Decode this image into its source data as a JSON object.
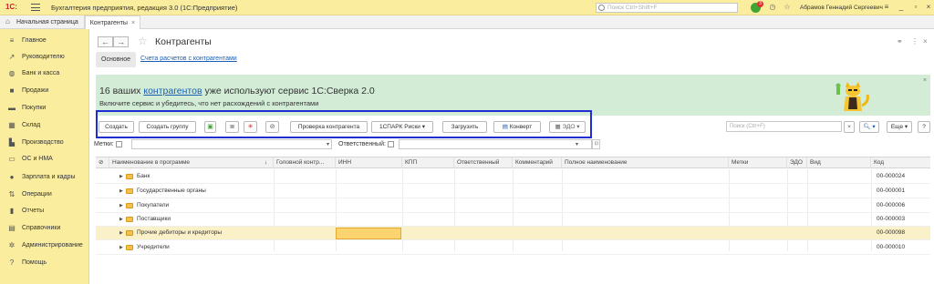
{
  "titlebar": {
    "logo": "1С:",
    "title": "Бухгалтерия предприятия, редакция 3.0  (1С:Предприятие)",
    "search_placeholder": "Поиск Ctrl+Shift+F",
    "notif_count": "3",
    "user": "Абрамов Геннадий Сергеевич"
  },
  "tabs": {
    "home": "Начальная страница",
    "active": "Контрагенты",
    "close": "×"
  },
  "sidebar": {
    "items": [
      {
        "label": "Главное",
        "icon": "menu-icon"
      },
      {
        "label": "Руководителю",
        "icon": "chart-icon"
      },
      {
        "label": "Банк и касса",
        "icon": "bank-icon"
      },
      {
        "label": "Продажи",
        "icon": "bag-icon"
      },
      {
        "label": "Покупки",
        "icon": "cart-icon"
      },
      {
        "label": "Склад",
        "icon": "warehouse-icon"
      },
      {
        "label": "Производство",
        "icon": "factory-icon"
      },
      {
        "label": "ОС и НМА",
        "icon": "assets-icon"
      },
      {
        "label": "Зарплата и кадры",
        "icon": "person-icon"
      },
      {
        "label": "Операции",
        "icon": "operations-icon"
      },
      {
        "label": "Отчеты",
        "icon": "reports-icon"
      },
      {
        "label": "Справочники",
        "icon": "book-icon"
      },
      {
        "label": "Администрирование",
        "icon": "gear-icon"
      },
      {
        "label": "Помощь",
        "icon": "help-icon"
      }
    ]
  },
  "page": {
    "title": "Контрагенты",
    "subtab_main": "Основное",
    "subtab_link": "Счета расчетов с контрагентами"
  },
  "banner": {
    "prefix": "16 ваших ",
    "link": "контрагентов",
    "suffix": " уже используют сервис 1С:Сверка 2.0",
    "sub": "Включите сервис и убедитесь, что нет расхождений с контрагентами",
    "close": "×"
  },
  "toolbar": {
    "create": "Создать",
    "create_group": "Создать группу",
    "check": "Проверка контрагента",
    "spark": "1СПАРК Риски",
    "load": "Загрузить",
    "envelope": "Конверт",
    "edo": "ЭДО",
    "search_placeholder": "Поиск (Ctrl+F)",
    "more": "Еще",
    "help": "?"
  },
  "filters": {
    "labels": "Метки:",
    "responsible": "Ответственный:"
  },
  "table": {
    "columns": [
      "Наименование в программе",
      "Головной контр...",
      "ИНН",
      "КПП",
      "Ответственный",
      "Комментарий",
      "Полное наименование",
      "Метки",
      "ЭДО",
      "Вид",
      "Код"
    ],
    "sort_mark": "↓",
    "rows": [
      {
        "name": "Банк",
        "code": "00-000024"
      },
      {
        "name": "Государственные органы",
        "code": "00-000001"
      },
      {
        "name": "Покупатели",
        "code": "00-000006"
      },
      {
        "name": "Поставщики",
        "code": "00-000003"
      },
      {
        "name": "Прочие дебиторы и кредиторы",
        "code": "00-000098"
      },
      {
        "name": "Учредители",
        "code": "00-000010"
      }
    ]
  },
  "colors": {
    "accent": "#fbed9e",
    "banner": "#d2ecd6",
    "highlight_frame": "#1e2ed0",
    "selected_row": "#fbf1c8"
  }
}
